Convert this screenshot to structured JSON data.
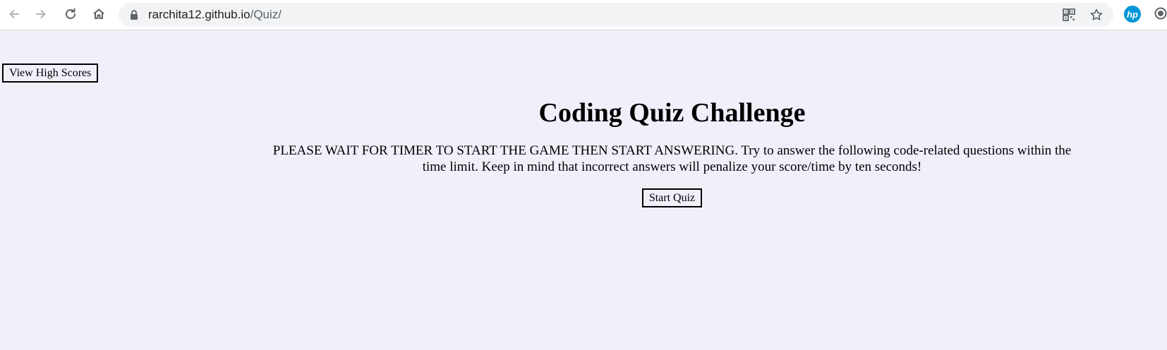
{
  "browser": {
    "url_host": "rarchita12.github.io",
    "url_path": "/Quiz/",
    "back_icon": "arrow-left-icon",
    "forward_icon": "arrow-right-icon",
    "reload_icon": "reload-icon",
    "home_icon": "home-icon",
    "lock_icon": "lock-icon",
    "qr_icon": "qr-code-icon",
    "bookmark_icon": "star-icon",
    "extension_label": "hp",
    "profile_icon": "profile-icon"
  },
  "page": {
    "high_scores_label": "View High Scores",
    "title": "Coding Quiz Challenge",
    "instructions": "PLEASE WAIT FOR TIMER TO START THE GAME THEN START ANSWERING. Try to answer the following code-related questions within the time limit. Keep in mind that incorrect answers will penalize your score/time by ten seconds!",
    "start_label": "Start Quiz"
  },
  "colors": {
    "page_background": "#f0f0fa",
    "toolbar_background": "#ffffff",
    "omnibox_background": "#f1f3f4",
    "hp_blue": "#0096d6"
  }
}
